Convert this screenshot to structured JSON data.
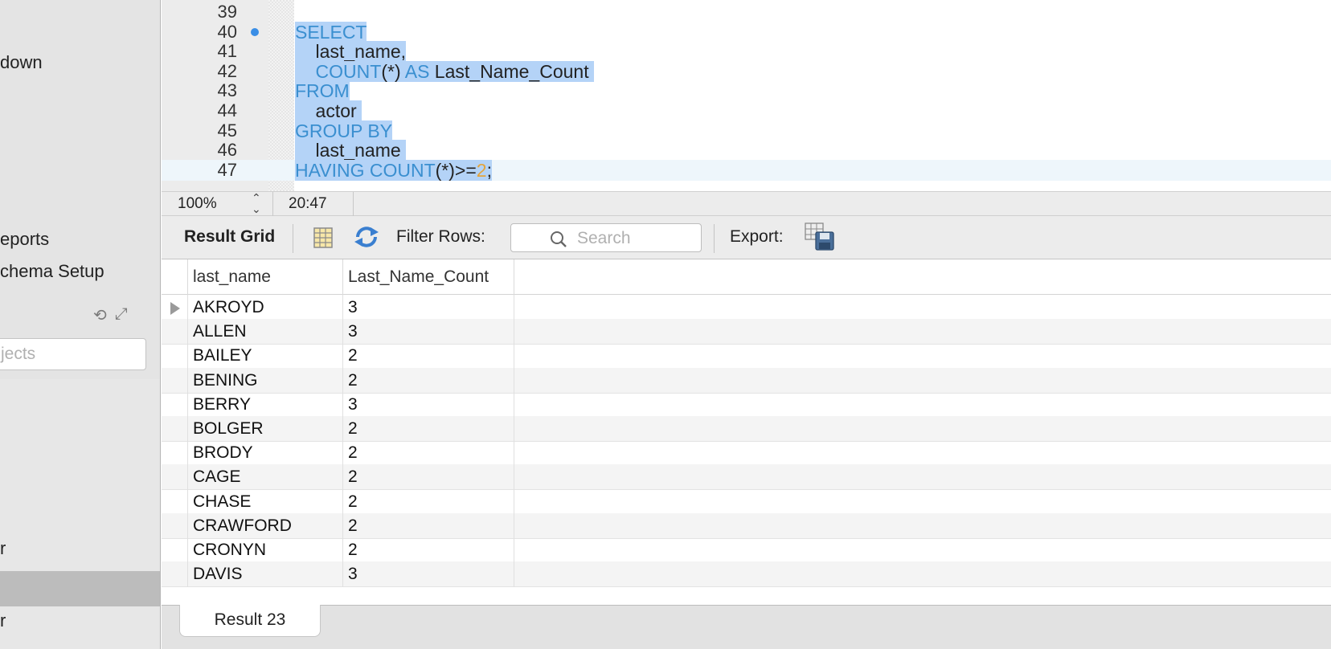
{
  "sidebar": {
    "items": [
      {
        "label": "down"
      },
      {
        "label": "eports"
      },
      {
        "label": "chema Setup"
      },
      {
        "label": "r"
      },
      {
        "label": "r"
      }
    ],
    "search_placeholder": "jects"
  },
  "editor": {
    "lines": [
      {
        "num": "39",
        "parts": []
      },
      {
        "num": "40",
        "parts": [
          {
            "t": "SELECT",
            "c": "kw"
          }
        ]
      },
      {
        "num": "41",
        "parts": [
          {
            "t": "    last_name,",
            "c": "plain"
          }
        ]
      },
      {
        "num": "42",
        "parts": [
          {
            "t": "    COUNT",
            "c": "kw"
          },
          {
            "t": "(*) ",
            "c": "plain"
          },
          {
            "t": "AS",
            "c": "kw"
          },
          {
            "t": " Last_Name_Count ",
            "c": "plain"
          }
        ]
      },
      {
        "num": "43",
        "parts": [
          {
            "t": "FROM",
            "c": "kw"
          }
        ]
      },
      {
        "num": "44",
        "parts": [
          {
            "t": "    actor ",
            "c": "plain"
          }
        ]
      },
      {
        "num": "45",
        "parts": [
          {
            "t": "GROUP BY",
            "c": "kw"
          }
        ]
      },
      {
        "num": "46",
        "parts": [
          {
            "t": "    last_name ",
            "c": "plain"
          }
        ]
      },
      {
        "num": "47",
        "parts": [
          {
            "t": "HAVING COUNT",
            "c": "kw"
          },
          {
            "t": "(*)>=",
            "c": "plain"
          },
          {
            "t": "2",
            "c": "num"
          },
          {
            "t": ";",
            "c": "plain"
          }
        ]
      }
    ]
  },
  "statusbar": {
    "zoom": "100%",
    "cursor": "20:47"
  },
  "toolbar": {
    "result_grid_label": "Result Grid",
    "filter_label": "Filter Rows:",
    "search_placeholder": "Search",
    "export_label": "Export:"
  },
  "grid": {
    "columns": [
      "last_name",
      "Last_Name_Count"
    ],
    "rows": [
      [
        "AKROYD",
        "3"
      ],
      [
        "ALLEN",
        "3"
      ],
      [
        "BAILEY",
        "2"
      ],
      [
        "BENING",
        "2"
      ],
      [
        "BERRY",
        "3"
      ],
      [
        "BOLGER",
        "2"
      ],
      [
        "BRODY",
        "2"
      ],
      [
        "CAGE",
        "2"
      ],
      [
        "CHASE",
        "2"
      ],
      [
        "CRAWFORD",
        "2"
      ],
      [
        "CRONYN",
        "2"
      ],
      [
        "DAVIS",
        "3"
      ]
    ]
  },
  "tabs": {
    "result_tab": "Result 23"
  },
  "colors": {
    "keyword": "#3a8fd0",
    "number": "#e3a43c",
    "selection": "#b4d3f7",
    "breakpoint": "#3a8ee6"
  }
}
